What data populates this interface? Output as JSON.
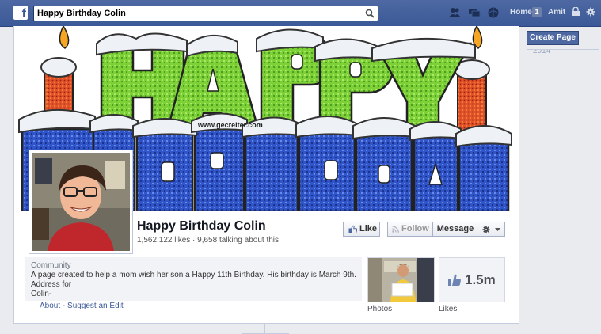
{
  "search": {
    "value": "Happy Birthday Colin"
  },
  "topnav": {
    "home_label": "Home",
    "home_count": "1",
    "user_label": "Amit"
  },
  "sidebar": {
    "create_page_label": "Create Page",
    "timeline_year": "2014"
  },
  "cover": {
    "watermark": "www.gecrelter.com"
  },
  "page": {
    "name": "Happy Birthday Colin",
    "stats": "1,562,122 likes · 9,658 talking about this"
  },
  "actions": {
    "like_label": "Like",
    "follow_label": "Follow",
    "message_label": "Message"
  },
  "about": {
    "category": "Community",
    "line1": "A page created to help a mom wish her son a Happy 11th Birthday. His birthday is March 9th.",
    "line2": "Address for",
    "line3": "Colin-",
    "links": "About - Suggest an Edit"
  },
  "apps": {
    "photos_label": "Photos",
    "likes_count": "1.5m",
    "likes_label": "Likes"
  },
  "colors": {
    "brand_blue": "#3b5998",
    "cover_green": "#7ed321",
    "cover_blue": "#2f4fc4"
  },
  "icons": [
    "facebook-logo-icon",
    "search-icon",
    "friend-requests-icon",
    "messages-icon",
    "notifications-icon",
    "privacy-icon",
    "settings-icon",
    "thumbs-up-icon",
    "rss-icon",
    "gear-icon",
    "caret-down-icon"
  ]
}
